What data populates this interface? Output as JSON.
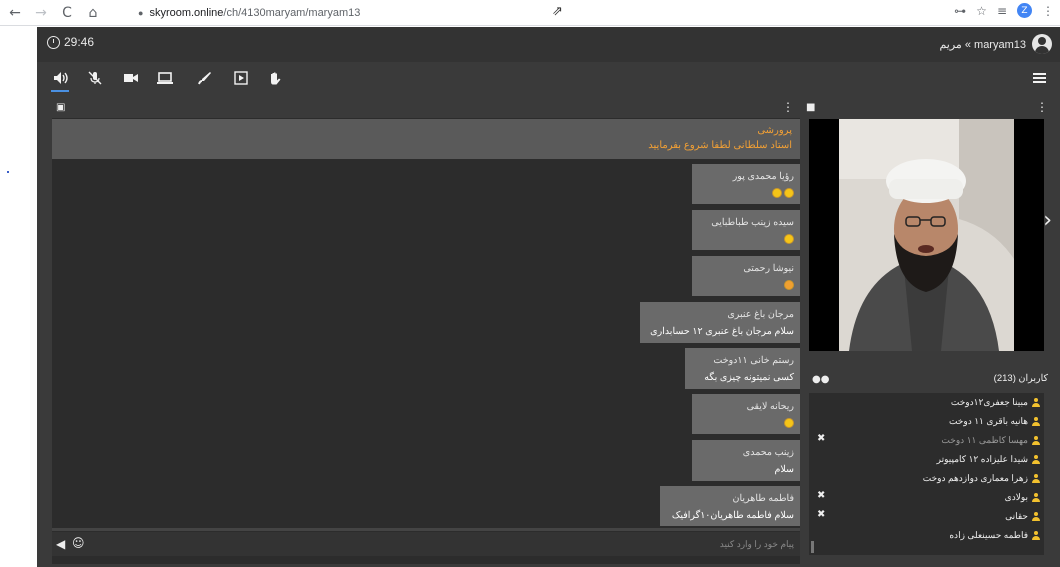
{
  "browser": {
    "back": "←",
    "forward": "→",
    "reload": "C",
    "home": "⌂",
    "url_host": "skyroom.online",
    "url_path": "/ch/4130maryam/maryam13",
    "profile_initial": "Z",
    "key_icon": "⊶",
    "star_icon": "☆",
    "media_icon": "≡",
    "more_icon": "⋮"
  },
  "header": {
    "timer": "29:46",
    "user_display": "maryam13 » مریم"
  },
  "toolbar": {
    "items": [
      "speaker-icon",
      "mic-off-icon",
      "camera-icon",
      "screen-share-icon",
      "pen-icon",
      "play-icon",
      "hand-icon"
    ]
  },
  "chat": {
    "pinned": {
      "name": "پرورشی",
      "text": "استاد سلطانی لطفا شروع بفرمایید"
    },
    "messages": [
      {
        "name": "رؤیا محمدی پور",
        "text": "",
        "emojis": 2
      },
      {
        "name": "سیده زینب طباطبایی",
        "text": "",
        "emojis": 1
      },
      {
        "name": "نیوشا رحمتی",
        "text": "",
        "emojis": 1
      },
      {
        "name": "مرجان باغ عنبری",
        "text": "سلام مرجان باغ عنبری ۱۲ حسابداری",
        "emojis": 0
      },
      {
        "name": "رستم خانی ۱۱دوخت",
        "text": "کسی نمیتونه چیزی بگه",
        "emojis": 0
      },
      {
        "name": "ریحانه لایقی",
        "text": "",
        "emojis": 1
      },
      {
        "name": "زینب محمدی",
        "text": "سلام",
        "emojis": 0
      },
      {
        "name": "فاطمه طاهریان",
        "text": "سلام فاطمه طاهریان۱۰گرافیک",
        "emojis": 0
      }
    ],
    "input_placeholder": "پیام خود را وارد کنید"
  },
  "users": {
    "title": "کاربران (213)",
    "list": [
      {
        "name": "مبینا جعفری۱۲دوخت",
        "dim": false,
        "mic_off": false
      },
      {
        "name": "هانیه باقری ۱۱ دوخت",
        "dim": false,
        "mic_off": false
      },
      {
        "name": "مهسا کاظمی ۱۱ دوخت",
        "dim": true,
        "mic_off": true
      },
      {
        "name": "شیدا علیزاده ۱۲ کامپیوتر",
        "dim": false,
        "mic_off": false
      },
      {
        "name": "زهرا معماری دوازدهم دوخت",
        "dim": false,
        "mic_off": false
      },
      {
        "name": "بولادی",
        "dim": false,
        "mic_off": true
      },
      {
        "name": "حقانی",
        "dim": false,
        "mic_off": true
      },
      {
        "name": "فاطمه حسینعلی زاده",
        "dim": false,
        "mic_off": false
      }
    ]
  },
  "colors": {
    "accent": "#4a90e2",
    "pinned_text": "#f2a035",
    "user_icon": "#f2c12e"
  }
}
